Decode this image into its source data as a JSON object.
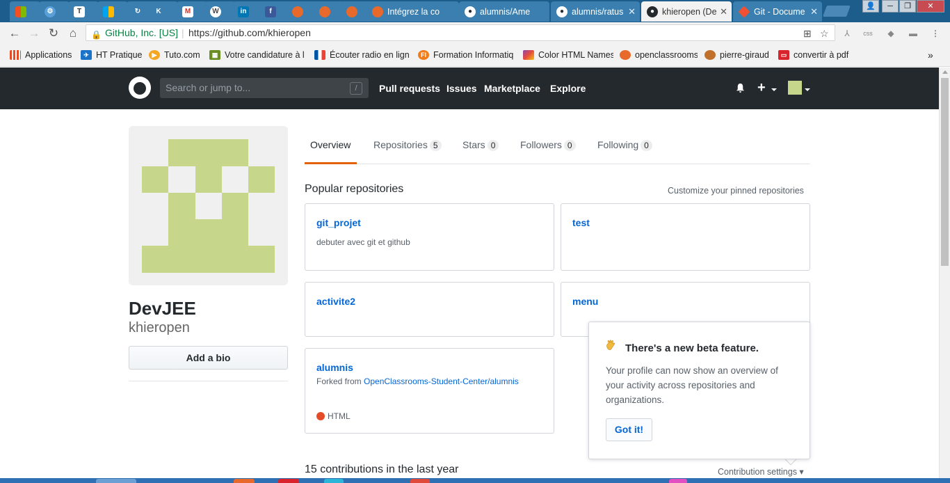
{
  "browser": {
    "tabs": [
      {
        "label": "",
        "icon": "windows-icon",
        "color": "#f25022"
      },
      {
        "label": "",
        "icon": "settings-icon",
        "color": "#5aa0d8"
      },
      {
        "label": "",
        "icon": "ti-icon",
        "color": "#ffffff"
      },
      {
        "label": "",
        "icon": "windows-icon",
        "color": "#00a4ef"
      },
      {
        "label": "",
        "icon": "refresh-icon",
        "color": "#5aa0d8"
      },
      {
        "label": "",
        "icon": "kb-icon",
        "color": "#3b78c4"
      },
      {
        "label": "",
        "icon": "gmail-icon",
        "color": "#d93025"
      },
      {
        "label": "",
        "icon": "wordpress-icon",
        "color": "#464646"
      },
      {
        "label": "",
        "icon": "linkedin-icon",
        "color": "#0077b5"
      },
      {
        "label": "",
        "icon": "facebook-icon",
        "color": "#3b5998"
      },
      {
        "label": "",
        "icon": "openclassrooms-icon",
        "color": "#e8692c"
      },
      {
        "label": "",
        "icon": "openclassrooms-icon",
        "color": "#e8692c"
      },
      {
        "label": "",
        "icon": "openclassrooms-icon",
        "color": "#e8692c"
      },
      {
        "label": "Intégrez la co",
        "icon": "openclassrooms-icon",
        "color": "#e8692c"
      },
      {
        "label": "alumnis/Ame",
        "icon": "github-icon",
        "color": "#24292e"
      },
      {
        "label": "alumnis/ratus",
        "icon": "github-icon",
        "color": "#24292e"
      },
      {
        "label": "khieropen (De",
        "icon": "github-icon",
        "color": "#24292e",
        "active": true
      },
      {
        "label": "Git - Docume",
        "icon": "git-icon",
        "color": "#f05033"
      }
    ],
    "omnibox": {
      "site_identity": "GitHub, Inc. [US]",
      "url": "https://github.com/khieropen",
      "separator": "|"
    },
    "bookmarks": [
      {
        "label": "Applications",
        "icon": "apps-grid-icon",
        "color": "#e44d26"
      },
      {
        "label": "HT Pratique",
        "icon": "ht-icon",
        "color": "#1a73c8"
      },
      {
        "label": "Tuto.com",
        "icon": "tuto-icon",
        "color": "#f5a623"
      },
      {
        "label": "Votre candidature à l",
        "icon": "form-icon",
        "color": "#6b8e23"
      },
      {
        "label": "Écouter radio en ligne",
        "icon": "france-flag-icon",
        "color": "#0055a4"
      },
      {
        "label": "Formation Informatiq",
        "icon": "fi-icon",
        "color": "#f07d1a"
      },
      {
        "label": "Color HTML Names",
        "icon": "color-icon",
        "color": "#8e44ad"
      },
      {
        "label": "openclassrooms",
        "icon": "openclassrooms-icon",
        "color": "#e8692c"
      },
      {
        "label": "pierre-giraud",
        "icon": "pg-icon",
        "color": "#c0702a"
      },
      {
        "label": "convertir à pdf",
        "icon": "pdf-icon",
        "color": "#d9232d"
      }
    ],
    "bookmarks_overflow": "»"
  },
  "github": {
    "search_placeholder": "Search or jump to...",
    "search_shortcut": "/",
    "nav": [
      "Pull requests",
      "Issues",
      "Marketplace",
      "Explore"
    ],
    "plus": "+"
  },
  "profile": {
    "full_name": "DevJEE",
    "username": "khieropen",
    "add_bio_label": "Add a bio",
    "avatar_color": "#c6d68a",
    "tabs": [
      {
        "label": "Overview",
        "count": null,
        "selected": true
      },
      {
        "label": "Repositories",
        "count": "5"
      },
      {
        "label": "Stars",
        "count": "0"
      },
      {
        "label": "Followers",
        "count": "0"
      },
      {
        "label": "Following",
        "count": "0"
      }
    ],
    "popular_title": "Popular repositories",
    "customize_link": "Customize your pinned repositories",
    "repos": [
      {
        "name": "git_projet",
        "description": "debuter avec git et github"
      },
      {
        "name": "test",
        "description": ""
      },
      {
        "name": "activite2",
        "description": ""
      },
      {
        "name": "menu",
        "description": ""
      },
      {
        "name": "alumnis",
        "forked_prefix": "Forked from",
        "forked_source": "OpenClassrooms-Student-Center/alumnis",
        "language": "HTML",
        "language_color": "#e34c26"
      }
    ],
    "contributions_title": "15 contributions in the last year",
    "contribution_settings": "Contribution settings ▾"
  },
  "popover": {
    "title": "There's a new beta feature.",
    "body": "Your profile can now show an overview of your activity across repositories and organizations.",
    "button": "Got it!",
    "icon": "waving-hand-icon"
  },
  "colors": {
    "tabstrip": "#1c5d8c",
    "github_header": "#24292e",
    "link": "#0366d6",
    "tab_underline": "#e36209"
  }
}
